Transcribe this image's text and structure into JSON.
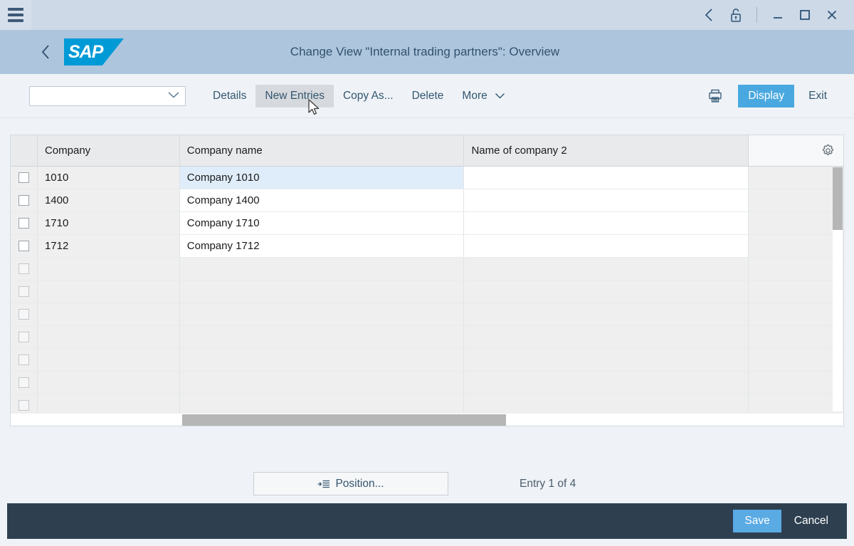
{
  "shellbar": {
    "menu_icon": "hamburger-icon",
    "back_icon": "chevron-left-icon",
    "lock_icon": "unlock-icon",
    "minimize_icon": "minimize-icon",
    "maximize_icon": "maximize-icon",
    "close_icon": "close-icon"
  },
  "header": {
    "back_icon": "back-chevron-icon",
    "logo_text": "SAP",
    "title": "Change View \"Internal trading partners\": Overview"
  },
  "toolbar": {
    "view_select_value": "",
    "view_select_placeholder": "",
    "details_label": "Details",
    "new_entries_label": "New Entries",
    "copy_as_label": "Copy As...",
    "delete_label": "Delete",
    "more_label": "More",
    "more_chevron": "⌄",
    "print_icon": "printer-icon",
    "display_label": "Display",
    "exit_label": "Exit"
  },
  "table": {
    "columns": [
      {
        "key": "check",
        "label": ""
      },
      {
        "key": "company",
        "label": "Company"
      },
      {
        "key": "cname",
        "label": "Company name"
      },
      {
        "key": "cname2",
        "label": "Name of company 2"
      },
      {
        "key": "settings",
        "label": ""
      }
    ],
    "settings_icon": "gear-icon",
    "rows": [
      {
        "company": "1010",
        "cname": "Company 1010",
        "cname2": ""
      },
      {
        "company": "1400",
        "cname": "Company 1400",
        "cname2": ""
      },
      {
        "company": "1710",
        "cname": "Company 1710",
        "cname2": ""
      },
      {
        "company": "1712",
        "cname": "Company 1712",
        "cname2": ""
      }
    ],
    "empty_row_count": 7,
    "focused_cell": "row0-cname"
  },
  "bottom": {
    "position_label": "Position...",
    "position_icon": "goto-list-icon",
    "entry_text": "Entry 1 of 4"
  },
  "footer": {
    "save_label": "Save",
    "cancel_label": "Cancel"
  },
  "colors": {
    "shellbar_bg": "#cdd9e7",
    "header_bg": "#adc6dd",
    "accent_blue": "#4aa8e0",
    "sap_logo_blue": "#009ad7",
    "footer_bg": "#2e4050",
    "focused_cell": "#dfecf9"
  }
}
